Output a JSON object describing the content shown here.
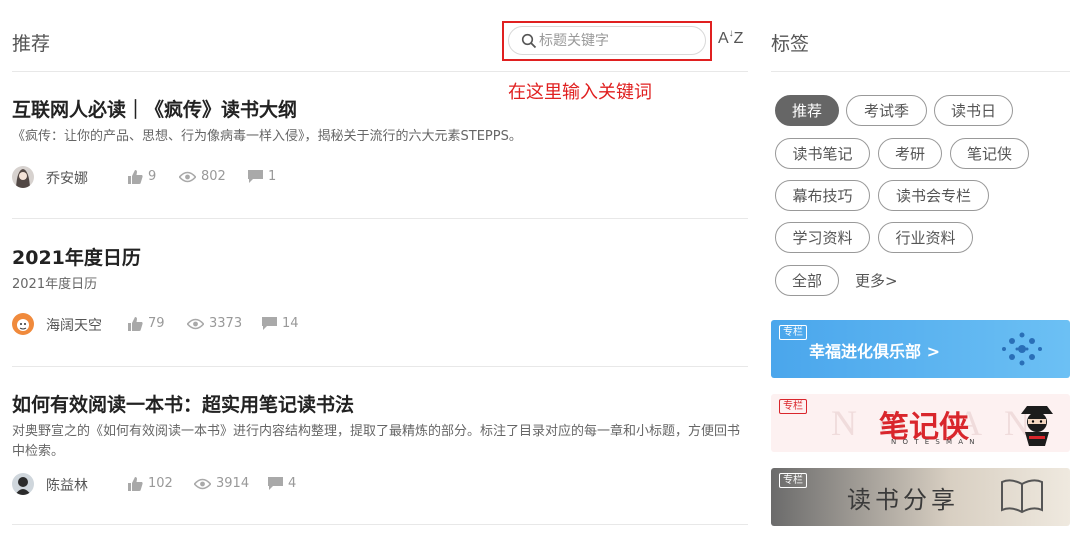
{
  "header": {
    "title": "推荐"
  },
  "search": {
    "placeholder": "标题关键字",
    "value": ""
  },
  "sort": {
    "label": "AZ"
  },
  "annotation": "在这里输入关键词",
  "articles": [
    {
      "title": "互联网人必读｜《疯传》读书大纲",
      "desc": "《疯传：让你的产品、思想、行为像病毒一样入侵》，揭秘关于流行的六大元素STEPPS。",
      "author": "乔安娜",
      "likes": "9",
      "views": "802",
      "comments": "1"
    },
    {
      "title": "2021年度日历",
      "desc": "2021年度日历",
      "author": "海阔天空",
      "likes": "79",
      "views": "3373",
      "comments": "14"
    },
    {
      "title": "如何有效阅读一本书：超实用笔记读书法",
      "desc": "对奥野宣之的《如何有效阅读一本书》进行内容结构整理，提取了最精炼的部分。标注了目录对应的每一章和小标题，方便回书中检索。",
      "author": "陈益林",
      "likes": "102",
      "views": "3914",
      "comments": "4"
    }
  ],
  "tags": {
    "title": "标签",
    "items": [
      "推荐",
      "考试季",
      "读书日",
      "读书笔记",
      "考研",
      "笔记侠",
      "幕布技巧",
      "读书会专栏",
      "学习资料",
      "行业资料",
      "全部"
    ],
    "more": "更多>"
  },
  "banners": [
    {
      "badge": "专栏",
      "text": "幸福进化俱乐部 >",
      "color": "#4aa6ec"
    },
    {
      "badge": "专栏",
      "text": "笔记侠",
      "sub": "N O T E S M A N",
      "color": "#d9262c"
    },
    {
      "badge": "专栏",
      "text": "读书分享",
      "color": "#5a5a5a"
    }
  ],
  "colors": {
    "annotation": "#e02020",
    "active_tag": "#666666"
  }
}
